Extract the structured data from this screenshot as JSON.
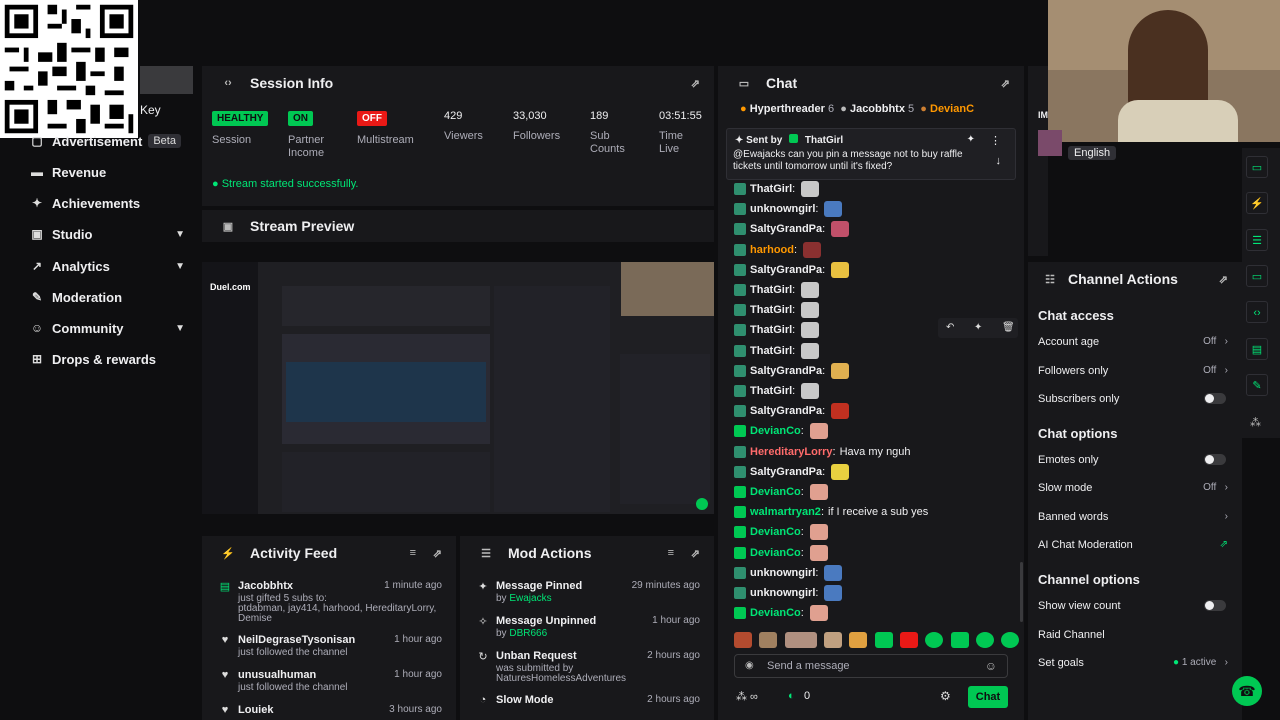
{
  "nav": {
    "key_label": "Key",
    "advertisement": "Advertisement",
    "beta": "Beta",
    "revenue": "Revenue",
    "achievements": "Achievements",
    "studio": "Studio",
    "analytics": "Analytics",
    "moderation": "Moderation",
    "community": "Community",
    "drops": "Drops & rewards"
  },
  "session": {
    "title": "Session Info",
    "healthy": "HEALTHY",
    "session_label": "Session",
    "on": "ON",
    "partner_income": "Partner Income",
    "off": "OFF",
    "multistream": "Multistream",
    "viewers_value": "429",
    "viewers_label": "Viewers",
    "followers_value": "33,030",
    "followers_label": "Followers",
    "subs_value": "189",
    "subs_label": "Sub Counts",
    "time_value": "03:51:55",
    "time_label": "Time Live",
    "started": "Stream started successfully."
  },
  "preview": {
    "title": "Stream Preview",
    "overlay_logo": "Duel.com"
  },
  "activity": {
    "title": "Activity Feed",
    "items": [
      {
        "who": "Jacobbhtx",
        "time": "1 minute ago",
        "line1": "just gifted 5 subs to:",
        "line2": "ptdabman, jay414, harhood, HereditaryLorry,",
        "line3": "Demise"
      },
      {
        "who": "NeilDegraseTysonisan",
        "time": "1 hour ago",
        "line1": "just followed the channel"
      },
      {
        "who": "unusualhuman",
        "time": "1 hour ago",
        "line1": "just followed the channel"
      },
      {
        "who": "Louiek",
        "time": "3 hours ago"
      }
    ]
  },
  "mod": {
    "title": "Mod Actions",
    "items": [
      {
        "what": "Message Pinned",
        "time": "29 minutes ago",
        "by": "by",
        "actor": "Ewajacks"
      },
      {
        "what": "Message Unpinned",
        "time": "1 hour ago",
        "by": "by",
        "actor": "DBR666"
      },
      {
        "what": "Unban Request",
        "time": "2 hours ago",
        "by": "was submitted by",
        "actor": "NaturesHomelessAdventures"
      },
      {
        "what": "Slow Mode",
        "time": "2 hours ago"
      }
    ]
  },
  "chat": {
    "title": "Chat",
    "leaders": [
      {
        "name": "Hyperthreader",
        "count": "6"
      },
      {
        "name": "Jacobbhtx",
        "count": "5"
      },
      {
        "name": "DevianC",
        "count": ""
      }
    ],
    "pinned_by_label": "Sent by",
    "pinned_by": "ThatGirl",
    "pinned_text": "@Ewajacks can you pin a message not to buy raffle tickets until tomorrow until it's fixed?",
    "messages": [
      {
        "user": "ThatGirl",
        "color": "#efeff1",
        "text": ""
      },
      {
        "user": "unknowngirl",
        "color": "#efeff1",
        "text": ""
      },
      {
        "user": "SaltyGrandPa",
        "color": "#efeff1",
        "text": ""
      },
      {
        "user": "harhood",
        "color": "#ff9800",
        "text": ""
      },
      {
        "user": "SaltyGrandPa",
        "color": "#efeff1",
        "text": ""
      },
      {
        "user": "ThatGirl",
        "color": "#efeff1",
        "text": ""
      },
      {
        "user": "ThatGirl",
        "color": "#efeff1",
        "text": ""
      },
      {
        "user": "ThatGirl",
        "color": "#efeff1",
        "text": ""
      },
      {
        "user": "ThatGirl",
        "color": "#efeff1",
        "text": ""
      },
      {
        "user": "SaltyGrandPa",
        "color": "#efeff1",
        "text": ""
      },
      {
        "user": "ThatGirl",
        "color": "#efeff1",
        "text": ""
      },
      {
        "user": "SaltyGrandPa",
        "color": "#efeff1",
        "text": ""
      },
      {
        "user": "DevianCo",
        "color": "#00e676",
        "text": ""
      },
      {
        "user": "HereditaryLorry",
        "color": "#ff6b6b",
        "text": "Hava my nguh"
      },
      {
        "user": "SaltyGrandPa",
        "color": "#efeff1",
        "text": ""
      },
      {
        "user": "DevianCo",
        "color": "#00e676",
        "text": ""
      },
      {
        "user": "walmartryan2",
        "color": "#00e676",
        "text": "if I receive a sub yes"
      },
      {
        "user": "DevianCo",
        "color": "#00e676",
        "text": ""
      },
      {
        "user": "DevianCo",
        "color": "#00e676",
        "text": ""
      },
      {
        "user": "unknowngirl",
        "color": "#efeff1",
        "text": ""
      },
      {
        "user": "unknowngirl",
        "color": "#efeff1",
        "text": ""
      },
      {
        "user": "DevianCo",
        "color": "#00e676",
        "text": ""
      }
    ],
    "input_placeholder": "Send a message",
    "count": "0",
    "send_label": "Chat"
  },
  "webcam": {
    "language": "English"
  },
  "actions": {
    "title": "Channel Actions",
    "chat_access": "Chat access",
    "account_age": "Account age",
    "account_age_value": "Off",
    "followers_only": "Followers only",
    "followers_only_value": "Off",
    "subscribers_only": "Subscribers only",
    "chat_options": "Chat options",
    "emotes_only": "Emotes only",
    "slow_mode": "Slow mode",
    "slow_mode_value": "Off",
    "banned_words": "Banned words",
    "ai_moderation": "AI Chat Moderation",
    "channel_options": "Channel options",
    "show_view_count": "Show view count",
    "raid_channel": "Raid Channel",
    "set_goals": "Set goals",
    "goals_value": "1 active"
  }
}
